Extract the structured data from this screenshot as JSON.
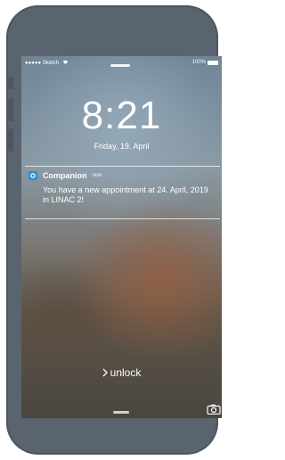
{
  "status_bar": {
    "carrier": "●●●●● Sketch",
    "battery_label": "100%"
  },
  "lock_screen": {
    "time": "8:21",
    "date": "Friday, 19. April",
    "unlock_label": "unlock"
  },
  "notification": {
    "app_name": "Companion",
    "timestamp": "now",
    "message": "You have a new appointment at 24. April, 2019 in LINAC 2!",
    "app_icon_color": "#2e8fd6"
  },
  "icons": [
    "wifi-icon",
    "battery-icon",
    "companion-app-icon",
    "chevron-right-icon",
    "camera-icon"
  ]
}
